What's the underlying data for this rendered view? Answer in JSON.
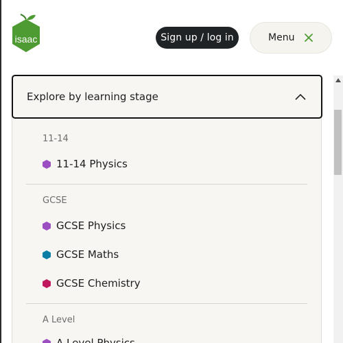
{
  "header": {
    "logo_text": "isaac",
    "signup_label": "Sign up / log in",
    "menu_label": "Menu"
  },
  "dropdown": {
    "title": "Explore by learning stage"
  },
  "stages": [
    {
      "label": "11-14",
      "subjects": [
        {
          "name": "11-14 Physics",
          "color": "#9b4fc1"
        }
      ]
    },
    {
      "label": "GCSE",
      "subjects": [
        {
          "name": "GCSE Physics",
          "color": "#9b4fc1"
        },
        {
          "name": "GCSE Maths",
          "color": "#0c7ea5"
        },
        {
          "name": "GCSE Chemistry",
          "color": "#c0185e"
        }
      ]
    },
    {
      "label": "A Level",
      "subjects": [
        {
          "name": "A Level Physics",
          "color": "#9b4fc1"
        }
      ]
    }
  ],
  "colors": {
    "brand_green": "#4e9b34",
    "button_dark": "#1f2326",
    "physics": "#9b4fc1",
    "maths": "#0c7ea5",
    "chemistry": "#c0185e"
  }
}
